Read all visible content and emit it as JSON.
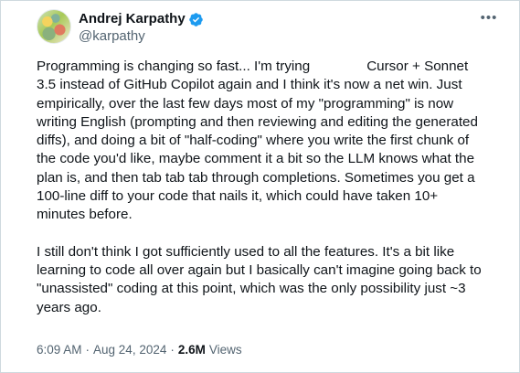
{
  "author": {
    "display_name": "Andrej Karpathy",
    "handle": "@karpathy",
    "verified_color": "#1d9bf0"
  },
  "more_icon": "ellipsis-horizontal",
  "tweet": {
    "paragraph_1_lines": [
      "Programming is changing so fast... I'm trying",
      "Cursor + Sonnet",
      "3.5 instead of GitHub Copilot again and I think it's now a net win. Just",
      "empirically, over the last few days most of my \"programming\" is now",
      "writing English (prompting and then reviewing and editing the generated",
      "diffs), and doing a bit of \"half-coding\" where you write the first chunk of",
      "the code you'd like, maybe comment it a bit so the LLM knows what the",
      "plan is, and then tab tab tab through completions. Sometimes you get a",
      "100-line diff to your code that nails it, which could have taken 10+",
      "minutes before."
    ],
    "paragraph_2_lines": [
      "I still don't think I got sufficiently used to all the features. It's a bit like",
      "learning to code all over again but I basically can't imagine going back to",
      "\"unassisted\" coding at this point, which was the only possibility just ~3",
      "years ago."
    ]
  },
  "meta": {
    "time": "6:09 AM",
    "separator_1": "·",
    "date": "Aug 24, 2024",
    "separator_2": "·",
    "views_count": "2.6M",
    "views_label": "Views"
  }
}
